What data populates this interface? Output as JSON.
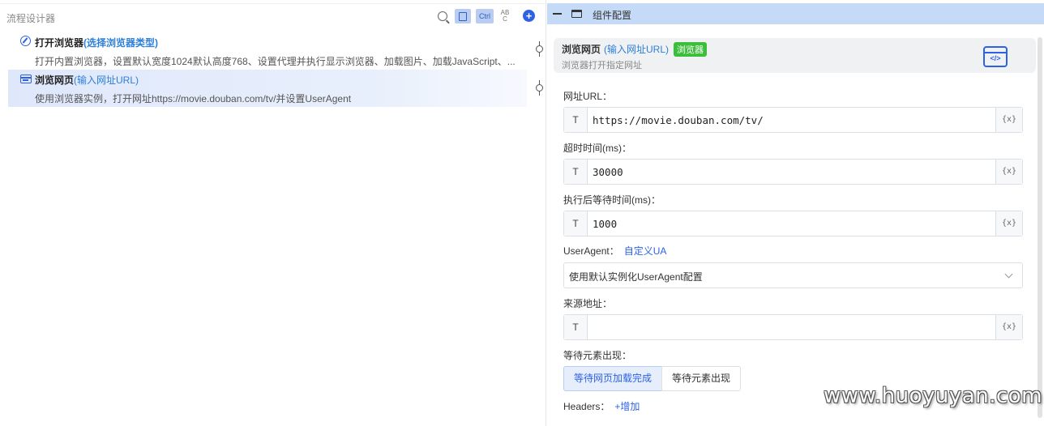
{
  "left_panel": {
    "title": "流程设计器",
    "toolbar": {
      "ctrl_label": "Ctrl",
      "abc_top": "AB",
      "abc_bottom": "C",
      "add_label": "+"
    },
    "steps": [
      {
        "icon": "compass-icon",
        "title": "打开浏览器",
        "hint": "(选择浏览器类型)",
        "description": "打开内置浏览器，设置默认宽度1024默认高度768、设置代理并执行显示浏览器、加载图片、加载JavaScript、..."
      },
      {
        "icon": "browser-icon",
        "title": "浏览网页",
        "hint": "(输入网址URL)",
        "description": "使用浏览器实例，打开网址https://movie.douban.com/tv/并设置UserAgent",
        "selected": true
      }
    ]
  },
  "right_panel": {
    "header_title": "组件配置",
    "card": {
      "title": "浏览网页",
      "hint": "(输入网址URL)",
      "badge": "浏览器",
      "subtitle": "浏览器打开指定网址",
      "icon_text": "</>"
    },
    "fields": {
      "url": {
        "label": "网址URL：",
        "type_tag": "T",
        "value": "https://movie.douban.com/tv/",
        "var_tag": "{x}"
      },
      "timeout": {
        "label": "超时时间(ms)：",
        "type_tag": "T",
        "value": "30000",
        "var_tag": "{x}"
      },
      "wait_after": {
        "label": "执行后等待时间(ms)：",
        "type_tag": "T",
        "value": "1000",
        "var_tag": "{x}"
      },
      "user_agent": {
        "label": "UserAgent：",
        "link": "自定义UA",
        "selected": "使用默认实例化UserAgent配置"
      },
      "referer": {
        "label": "来源地址：",
        "type_tag": "T",
        "value": "",
        "var_tag": "{x}"
      },
      "wait_element": {
        "label": "等待元素出现：",
        "options": [
          "等待网页加载完成",
          "等待元素出现"
        ],
        "active_index": 0
      },
      "headers": {
        "label": "Headers：",
        "link": "+增加"
      }
    }
  },
  "watermark": "www.huoyuyan.com",
  "colors": {
    "accent": "#2e62e6",
    "header_bg": "#c5daf7",
    "badge": "#3bbf3b",
    "link": "#2e7fd8"
  }
}
